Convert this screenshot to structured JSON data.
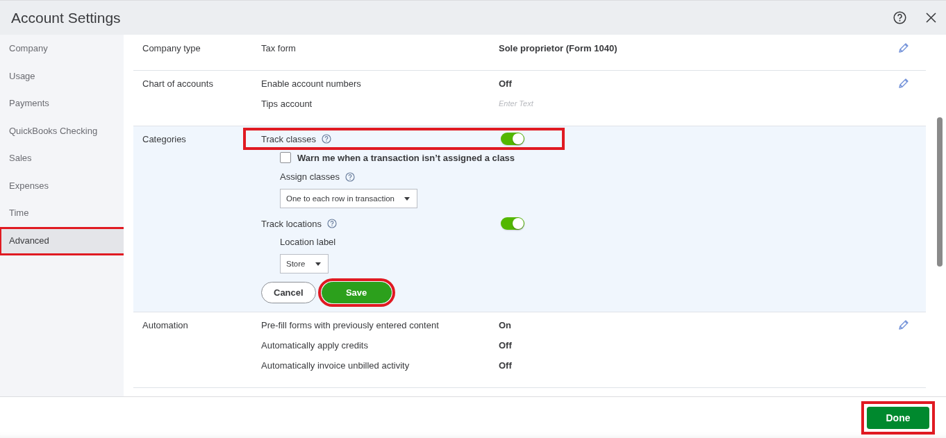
{
  "header": {
    "title": "Account Settings"
  },
  "sidebar": {
    "items": [
      {
        "label": "Company",
        "selected": false,
        "highlighted": false
      },
      {
        "label": "Usage",
        "selected": false,
        "highlighted": false
      },
      {
        "label": "Payments",
        "selected": false,
        "highlighted": false
      },
      {
        "label": "QuickBooks Checking",
        "selected": false,
        "highlighted": false
      },
      {
        "label": "Sales",
        "selected": false,
        "highlighted": false
      },
      {
        "label": "Expenses",
        "selected": false,
        "highlighted": false
      },
      {
        "label": "Time",
        "selected": false,
        "highlighted": false
      },
      {
        "label": "Advanced",
        "selected": true,
        "highlighted": true
      }
    ]
  },
  "sections": [
    {
      "kind": "static",
      "label": "Company type",
      "editable": true,
      "rows": [
        {
          "label": "Tax form",
          "value": "Sole proprietor (Form 1040)"
        }
      ]
    },
    {
      "kind": "static",
      "label": "Chart of accounts",
      "editable": true,
      "rows": [
        {
          "label": "Enable account numbers",
          "value": "Off"
        },
        {
          "label": "Tips account",
          "placeholder": "Enter Text"
        }
      ]
    },
    {
      "kind": "editing",
      "label": "Categories",
      "items": [
        {
          "kind": "toggle",
          "label": "Track classes",
          "help": true,
          "on": true,
          "highlighted": true,
          "children": [
            {
              "kind": "checkbox",
              "label": "Warn me when a transaction isn’t assigned a class",
              "checked": false
            },
            {
              "kind": "select",
              "label": "Assign classes",
              "help": true,
              "value": "One to each row in transaction"
            }
          ]
        },
        {
          "kind": "toggle",
          "label": "Track locations",
          "help": true,
          "on": true,
          "highlighted": false,
          "children": [
            {
              "kind": "select",
              "label": "Location label",
              "help": false,
              "value": "Store"
            }
          ]
        }
      ],
      "buttons": [
        {
          "kind": "secondary",
          "label": "Cancel",
          "highlighted": false
        },
        {
          "kind": "primary",
          "label": "Save",
          "highlighted": true
        }
      ]
    },
    {
      "kind": "static",
      "label": "Automation",
      "editable": true,
      "rows": [
        {
          "label": "Pre-fill forms with previously entered content",
          "value": "On"
        },
        {
          "label": "Automatically apply credits",
          "value": "Off"
        },
        {
          "label": "Automatically invoice unbilled activity",
          "value": "Off"
        }
      ]
    }
  ],
  "footer": {
    "button": {
      "label": "Done",
      "highlighted": true
    }
  }
}
